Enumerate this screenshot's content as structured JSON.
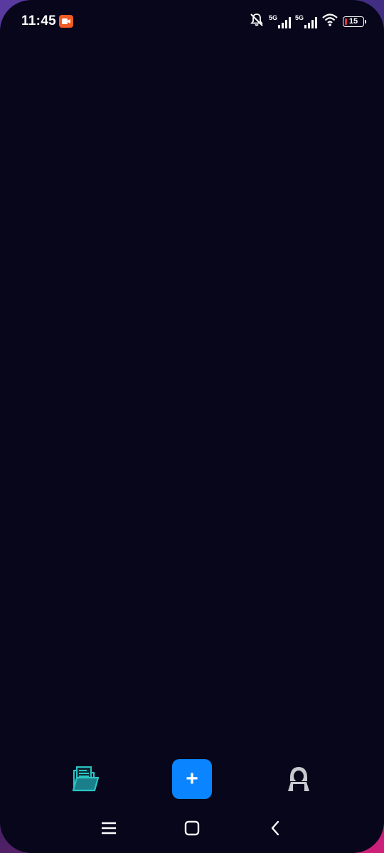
{
  "status_bar": {
    "time": "11:45",
    "recording_icon": "screen-record-icon",
    "icons": [
      "mute-bell-icon",
      "signal-5g-icon",
      "signal-5g-icon",
      "wifi-icon",
      "battery-icon"
    ],
    "network_1": "5G",
    "network_2": "5G",
    "battery_level": "15",
    "battery_color": "#e53030"
  },
  "main": {
    "background": "#07061a"
  },
  "bottom_nav": {
    "files_icon": "folder-icon",
    "add_label": "+",
    "add_color": "#0a84ff",
    "profile_icon": "hacker-avatar-icon"
  },
  "system_nav": {
    "items": [
      "menu-icon",
      "home-icon",
      "back-icon"
    ]
  }
}
